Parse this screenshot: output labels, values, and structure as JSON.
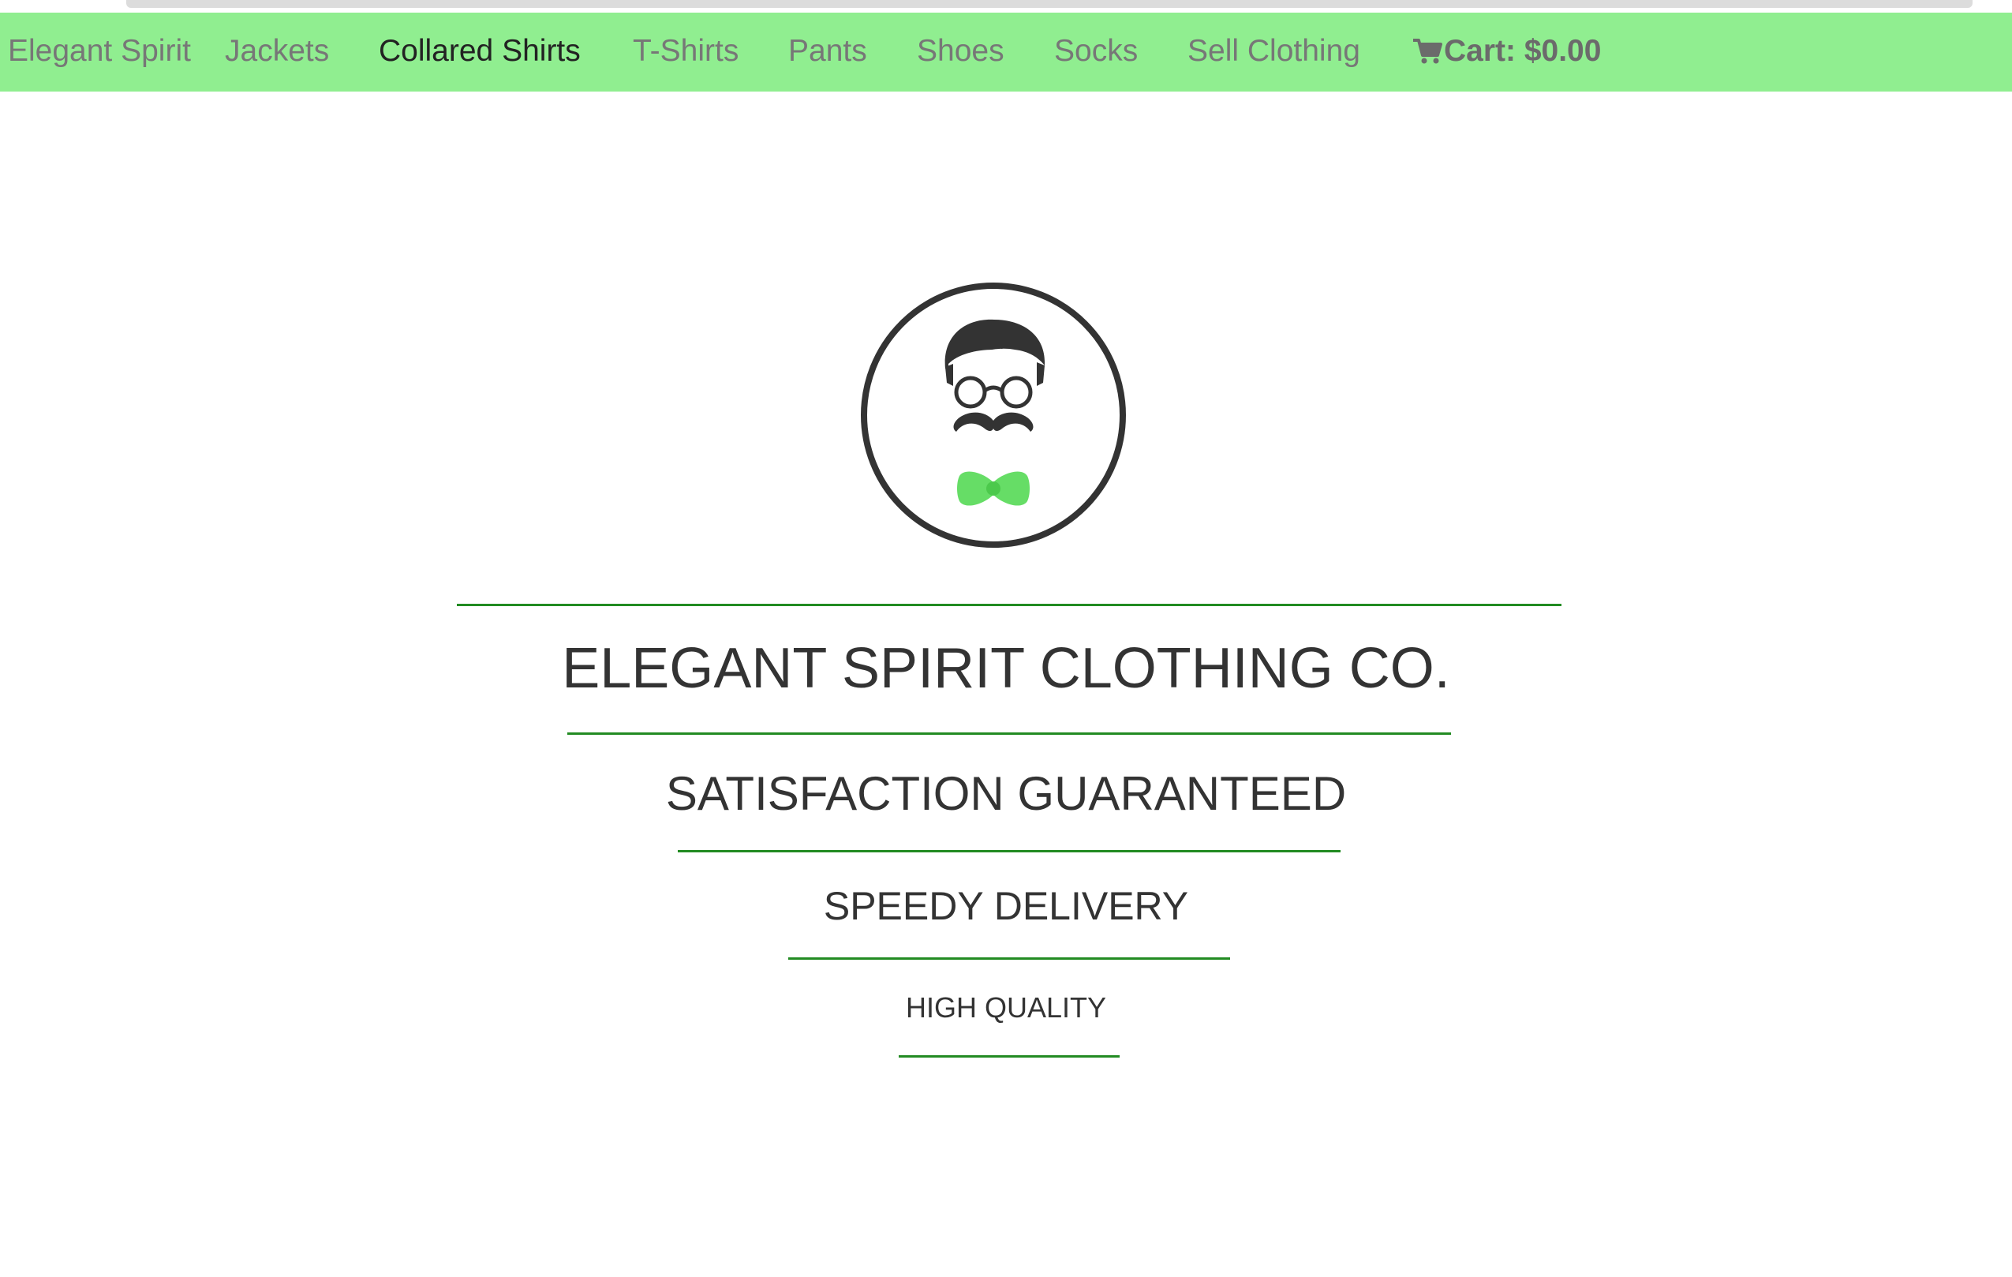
{
  "nav": {
    "brand": "Elegant Spirit",
    "items": [
      "Jackets",
      "Collared Shirts",
      "T-Shirts",
      "Pants",
      "Shoes",
      "Socks",
      "Sell Clothing"
    ],
    "cart_label": "Cart: $0.00",
    "cart_icon": "shopping-cart-icon"
  },
  "hero": {
    "logo_icon": "gentleman-logo-icon",
    "title": "ELEGANT SPIRIT CLOTHING CO.",
    "taglines": [
      "SATISFACTION GUARANTEED",
      "SPEEDY DELIVERY",
      "HIGH QUALITY"
    ]
  },
  "colors": {
    "navbar_bg": "#90ee90",
    "accent_line": "#228b22",
    "bowtie": "#66dd66",
    "text": "#333333"
  }
}
